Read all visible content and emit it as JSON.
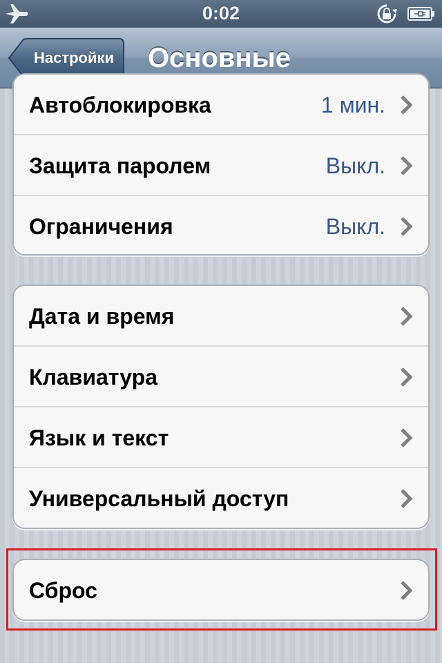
{
  "status_bar": {
    "time": "0:02",
    "airplane_icon": "airplane-icon",
    "rotation_lock_icon": "rotation-lock-icon",
    "battery_icon": "battery-charging-icon"
  },
  "nav": {
    "back_label": "Настройки",
    "title": "Основные"
  },
  "groups": [
    {
      "rows": [
        {
          "label": "Автоблокировка",
          "value": "1 мин."
        },
        {
          "label": "Защита паролем",
          "value": "Выкл."
        },
        {
          "label": "Ограничения",
          "value": "Выкл."
        }
      ]
    },
    {
      "rows": [
        {
          "label": "Дата и время"
        },
        {
          "label": "Клавиатура"
        },
        {
          "label": "Язык и текст"
        },
        {
          "label": "Универсальный доступ"
        }
      ]
    },
    {
      "rows": [
        {
          "label": "Сброс"
        }
      ]
    }
  ],
  "colors": {
    "value_text": "#385487",
    "highlight_border": "#d91c26",
    "nav_bar": "#7e94ad"
  }
}
